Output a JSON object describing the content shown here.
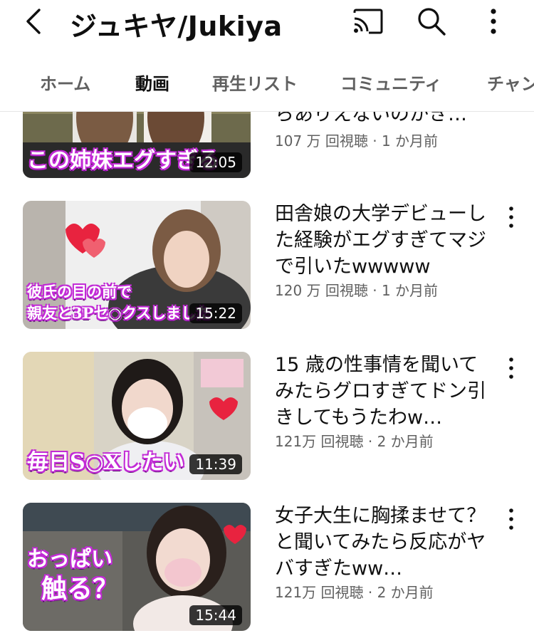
{
  "header": {
    "channel_title": "ジュキヤ/Jukiya",
    "back_icon": "back-chevron-icon",
    "cast_icon": "cast-icon",
    "search_icon": "search-icon",
    "more_icon": "more-vertical-icon"
  },
  "tabs": [
    {
      "label": "ホーム",
      "active": false
    },
    {
      "label": "動画",
      "active": true
    },
    {
      "label": "再生リスト",
      "active": false
    },
    {
      "label": "コミュニティ",
      "active": false
    },
    {
      "label": "チャン",
      "active": false
    }
  ],
  "videos": [
    {
      "title": "らありえないのかき…",
      "meta": "107 万 回視聴 · 1 か月前",
      "duration": "12:05",
      "thumb_caption": "この姉妹エグすぎる"
    },
    {
      "title": "田舎娘の大学デビューした経験がエグすぎてマジで引いたwwwww",
      "meta": "120 万 回視聴 · 1 か月前",
      "duration": "15:22",
      "thumb_caption_line1": "彼氏の目の前で",
      "thumb_caption_line2": "親友と3Pセ○クスしました"
    },
    {
      "title": "15 歳の性事情を聞いてみたらグロすぎてドン引きしてもうたわw…",
      "meta": "121万 回視聴 · 2 か月前",
      "duration": "11:39",
      "thumb_caption": "毎日S○Xしたい"
    },
    {
      "title": "女子大生に胸揉ませて？と聞いてみたら反応がヤバすぎたww…",
      "meta": "121万 回視聴 · 2 か月前",
      "duration": "15:44",
      "thumb_caption_line1": "おっぱい",
      "thumb_caption_line2": "触る？"
    }
  ],
  "colors": {
    "text_primary": "#0f0f0f",
    "text_secondary": "#606060",
    "caption_outline": "#c22ad6"
  }
}
